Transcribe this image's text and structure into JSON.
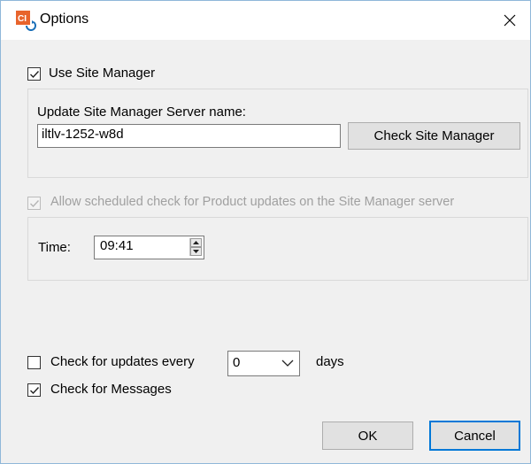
{
  "window": {
    "title": "Options",
    "app_icon_text": "CI"
  },
  "use_site_manager": {
    "label": "Use Site Manager",
    "checked": true
  },
  "site_manager_group": {
    "server_label": "Update Site Manager Server name:",
    "server_value": "iltlv-1252-w8d",
    "check_button": "Check Site Manager"
  },
  "scheduled_check": {
    "label": "Allow scheduled check for Product updates on the Site Manager server",
    "checked": true,
    "disabled": true
  },
  "time_group": {
    "label": "Time:",
    "value": "09:41"
  },
  "check_updates": {
    "label": "Check for updates every",
    "checked": false,
    "interval_value": "0",
    "unit": "days"
  },
  "check_messages": {
    "label": "Check for Messages",
    "checked": true
  },
  "footer": {
    "ok": "OK",
    "cancel": "Cancel"
  },
  "colors": {
    "accent": "#0078d7",
    "icon_orange": "#e8642c"
  },
  "icons": {
    "app": "app-logo-icon",
    "close": "close-icon",
    "check": "checkmark-icon",
    "spin_up": "spin-up-icon",
    "spin_down": "spin-down-icon",
    "dropdown": "chevron-down-icon"
  }
}
